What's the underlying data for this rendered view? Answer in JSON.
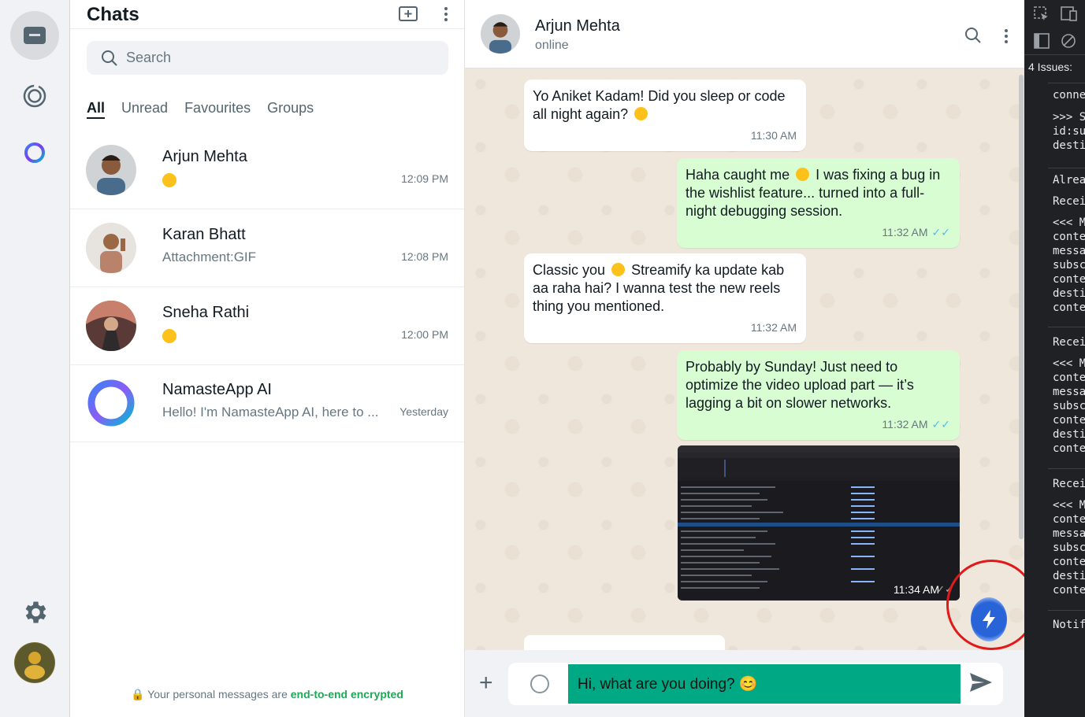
{
  "rail": {
    "items": [
      "chats-icon",
      "status-icon",
      "ai-icon"
    ],
    "bottom": [
      "settings-icon",
      "profile-avatar"
    ]
  },
  "chat_list": {
    "title": "Chats",
    "search_placeholder": "Search",
    "filters": [
      "All",
      "Unread",
      "Favourites",
      "Groups"
    ],
    "chats": [
      {
        "name": "Arjun Mehta",
        "preview": "",
        "time": "12:09 PM"
      },
      {
        "name": "Karan Bhatt",
        "preview": "Attachment:GIF",
        "time": "12:08 PM"
      },
      {
        "name": "Sneha Rathi",
        "preview": "",
        "time": "12:00 PM"
      },
      {
        "name": "NamasteApp AI",
        "preview": "Hello! I'm NamasteApp AI, here to ...",
        "time": "Yesterday"
      }
    ],
    "encryption_prefix": "Your personal messages are",
    "encryption_link": "end-to-end encrypted"
  },
  "conversation": {
    "name": "Arjun Mehta",
    "status": "online",
    "messages": [
      {
        "dir": "in",
        "text_a": "Yo Aniket Kadam! Did you sleep or code all night again?",
        "time": "11:30 AM"
      },
      {
        "dir": "out",
        "text_a": "Haha caught me",
        "text_b": "I was fixing a bug in the wishlist feature... turned into a full-night debugging session.",
        "time": "11:32 AM"
      },
      {
        "dir": "in",
        "text_a": "Classic you",
        "text_b": "Streamify ka update kab aa raha hai? I wanna test the new reels thing you mentioned.",
        "time": "11:32 AM"
      },
      {
        "dir": "out",
        "text_a": "Probably by Sunday! Just need to optimize the video upload part — it’s lagging a bit on slower networks.",
        "time": "11:32 AM"
      },
      {
        "dir": "out",
        "type": "image",
        "time": "11:34 AM"
      }
    ],
    "composer_value": "Hi, what are you doing? 😊"
  },
  "devtools": {
    "issues": "4 Issues:",
    "lines": [
      "conne",
      ">>> S",
      "id:su",
      "desti",
      "Alrea",
      "Recei",
      "<<< M",
      "conte",
      "messa",
      "subsc",
      "conte",
      "desti",
      "conte",
      "Recei",
      "<<< M",
      "conte",
      "messa",
      "subsc",
      "conte",
      "desti",
      "conte",
      "Recei",
      "<<< M",
      "conte",
      "messa",
      "subsc",
      "conte",
      "desti",
      "conte",
      "Notif"
    ]
  },
  "colors": {
    "accent": "#00a884",
    "outgoing": "#d9fdd3",
    "annotation": "#e01a1a"
  }
}
